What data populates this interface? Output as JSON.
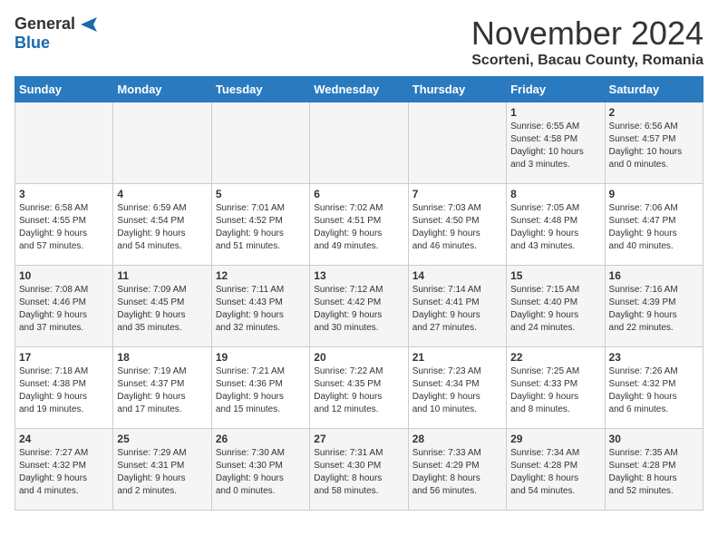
{
  "header": {
    "logo_general": "General",
    "logo_blue": "Blue",
    "month_title": "November 2024",
    "location": "Scorteni, Bacau County, Romania"
  },
  "weekdays": [
    "Sunday",
    "Monday",
    "Tuesday",
    "Wednesday",
    "Thursday",
    "Friday",
    "Saturday"
  ],
  "weeks": [
    [
      {
        "day": "",
        "info": ""
      },
      {
        "day": "",
        "info": ""
      },
      {
        "day": "",
        "info": ""
      },
      {
        "day": "",
        "info": ""
      },
      {
        "day": "",
        "info": ""
      },
      {
        "day": "1",
        "info": "Sunrise: 6:55 AM\nSunset: 4:58 PM\nDaylight: 10 hours\nand 3 minutes."
      },
      {
        "day": "2",
        "info": "Sunrise: 6:56 AM\nSunset: 4:57 PM\nDaylight: 10 hours\nand 0 minutes."
      }
    ],
    [
      {
        "day": "3",
        "info": "Sunrise: 6:58 AM\nSunset: 4:55 PM\nDaylight: 9 hours\nand 57 minutes."
      },
      {
        "day": "4",
        "info": "Sunrise: 6:59 AM\nSunset: 4:54 PM\nDaylight: 9 hours\nand 54 minutes."
      },
      {
        "day": "5",
        "info": "Sunrise: 7:01 AM\nSunset: 4:52 PM\nDaylight: 9 hours\nand 51 minutes."
      },
      {
        "day": "6",
        "info": "Sunrise: 7:02 AM\nSunset: 4:51 PM\nDaylight: 9 hours\nand 49 minutes."
      },
      {
        "day": "7",
        "info": "Sunrise: 7:03 AM\nSunset: 4:50 PM\nDaylight: 9 hours\nand 46 minutes."
      },
      {
        "day": "8",
        "info": "Sunrise: 7:05 AM\nSunset: 4:48 PM\nDaylight: 9 hours\nand 43 minutes."
      },
      {
        "day": "9",
        "info": "Sunrise: 7:06 AM\nSunset: 4:47 PM\nDaylight: 9 hours\nand 40 minutes."
      }
    ],
    [
      {
        "day": "10",
        "info": "Sunrise: 7:08 AM\nSunset: 4:46 PM\nDaylight: 9 hours\nand 37 minutes."
      },
      {
        "day": "11",
        "info": "Sunrise: 7:09 AM\nSunset: 4:45 PM\nDaylight: 9 hours\nand 35 minutes."
      },
      {
        "day": "12",
        "info": "Sunrise: 7:11 AM\nSunset: 4:43 PM\nDaylight: 9 hours\nand 32 minutes."
      },
      {
        "day": "13",
        "info": "Sunrise: 7:12 AM\nSunset: 4:42 PM\nDaylight: 9 hours\nand 30 minutes."
      },
      {
        "day": "14",
        "info": "Sunrise: 7:14 AM\nSunset: 4:41 PM\nDaylight: 9 hours\nand 27 minutes."
      },
      {
        "day": "15",
        "info": "Sunrise: 7:15 AM\nSunset: 4:40 PM\nDaylight: 9 hours\nand 24 minutes."
      },
      {
        "day": "16",
        "info": "Sunrise: 7:16 AM\nSunset: 4:39 PM\nDaylight: 9 hours\nand 22 minutes."
      }
    ],
    [
      {
        "day": "17",
        "info": "Sunrise: 7:18 AM\nSunset: 4:38 PM\nDaylight: 9 hours\nand 19 minutes."
      },
      {
        "day": "18",
        "info": "Sunrise: 7:19 AM\nSunset: 4:37 PM\nDaylight: 9 hours\nand 17 minutes."
      },
      {
        "day": "19",
        "info": "Sunrise: 7:21 AM\nSunset: 4:36 PM\nDaylight: 9 hours\nand 15 minutes."
      },
      {
        "day": "20",
        "info": "Sunrise: 7:22 AM\nSunset: 4:35 PM\nDaylight: 9 hours\nand 12 minutes."
      },
      {
        "day": "21",
        "info": "Sunrise: 7:23 AM\nSunset: 4:34 PM\nDaylight: 9 hours\nand 10 minutes."
      },
      {
        "day": "22",
        "info": "Sunrise: 7:25 AM\nSunset: 4:33 PM\nDaylight: 9 hours\nand 8 minutes."
      },
      {
        "day": "23",
        "info": "Sunrise: 7:26 AM\nSunset: 4:32 PM\nDaylight: 9 hours\nand 6 minutes."
      }
    ],
    [
      {
        "day": "24",
        "info": "Sunrise: 7:27 AM\nSunset: 4:32 PM\nDaylight: 9 hours\nand 4 minutes."
      },
      {
        "day": "25",
        "info": "Sunrise: 7:29 AM\nSunset: 4:31 PM\nDaylight: 9 hours\nand 2 minutes."
      },
      {
        "day": "26",
        "info": "Sunrise: 7:30 AM\nSunset: 4:30 PM\nDaylight: 9 hours\nand 0 minutes."
      },
      {
        "day": "27",
        "info": "Sunrise: 7:31 AM\nSunset: 4:30 PM\nDaylight: 8 hours\nand 58 minutes."
      },
      {
        "day": "28",
        "info": "Sunrise: 7:33 AM\nSunset: 4:29 PM\nDaylight: 8 hours\nand 56 minutes."
      },
      {
        "day": "29",
        "info": "Sunrise: 7:34 AM\nSunset: 4:28 PM\nDaylight: 8 hours\nand 54 minutes."
      },
      {
        "day": "30",
        "info": "Sunrise: 7:35 AM\nSunset: 4:28 PM\nDaylight: 8 hours\nand 52 minutes."
      }
    ]
  ]
}
